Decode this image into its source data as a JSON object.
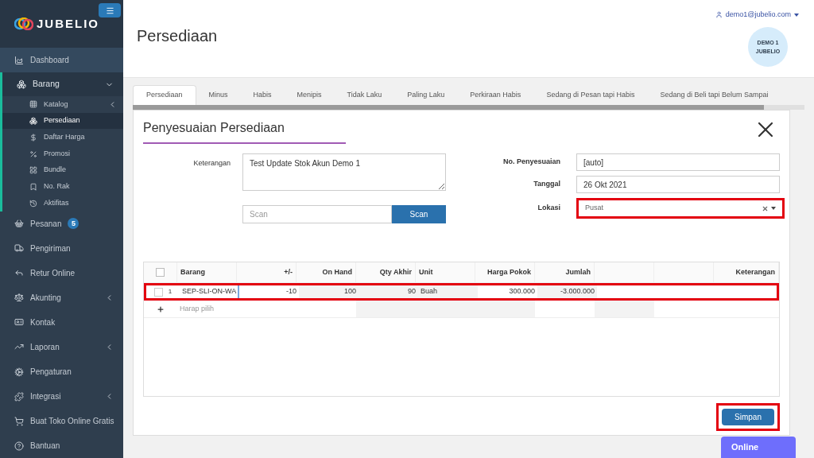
{
  "sidebar": {
    "logo": "JUBELIO",
    "items": [
      {
        "kind": "item",
        "label": "Dashboard"
      },
      {
        "kind": "group",
        "label": "Barang",
        "expanded": true,
        "children": [
          {
            "label": "Katalog",
            "selected": false
          },
          {
            "label": "Persediaan",
            "selected": true
          },
          {
            "label": "Daftar Harga",
            "selected": false
          },
          {
            "label": "Promosi",
            "selected": false
          },
          {
            "label": "Bundle",
            "selected": false
          },
          {
            "label": "No. Rak",
            "selected": false
          },
          {
            "label": "Aktifitas",
            "selected": false
          }
        ]
      },
      {
        "kind": "item",
        "label": "Pesanan",
        "badge": "5"
      },
      {
        "kind": "item",
        "label": "Pengiriman"
      },
      {
        "kind": "item",
        "label": "Retur Online"
      },
      {
        "kind": "item",
        "label": "Akunting"
      },
      {
        "kind": "item",
        "label": "Kontak"
      },
      {
        "kind": "item",
        "label": "Laporan"
      },
      {
        "kind": "item",
        "label": "Pengaturan"
      },
      {
        "kind": "item",
        "label": "Integrasi"
      },
      {
        "kind": "item",
        "label": "Buat Toko Online Gratis"
      },
      {
        "kind": "item",
        "label": "Bantuan"
      }
    ]
  },
  "header": {
    "title": "Persediaan",
    "user": "demo1@jubelio.com",
    "avatar": [
      "DEMO 1",
      "JUBELIO"
    ]
  },
  "tabs": [
    {
      "label": "Persediaan",
      "selected": true
    },
    {
      "label": "Minus",
      "selected": false
    },
    {
      "label": "Habis",
      "selected": false
    },
    {
      "label": "Menipis",
      "selected": false
    },
    {
      "label": "Tidak Laku",
      "selected": false
    },
    {
      "label": "Paling Laku",
      "selected": false
    },
    {
      "label": "Perkiraan Habis",
      "selected": false
    },
    {
      "label": "Sedang di Pesan tapi Habis",
      "selected": false
    },
    {
      "label": "Sedang di Beli tapi Belum Sampai",
      "selected": false
    }
  ],
  "form": {
    "title": "Penyesuaian Persediaan",
    "keterangan": {
      "label": "Keterangan",
      "value": "Test Update Stok Akun Demo 1"
    },
    "scan": {
      "placeholder": "Scan",
      "button": "Scan"
    },
    "no_penyesuaian": {
      "label": "No. Penyesuaian",
      "value": "[auto]"
    },
    "tanggal": {
      "label": "Tanggal",
      "value": "26 Okt 2021"
    },
    "lokasi": {
      "label": "Lokasi",
      "value": "Pusat",
      "highlighted": true
    }
  },
  "table": {
    "select_all": {
      "checked": false
    },
    "columns": [
      "Barang",
      "+/-",
      "On Hand",
      "Qty Akhir",
      "Unit",
      "Harga Pokok",
      "Jumlah",
      "",
      "",
      "Keterangan"
    ],
    "rows": [
      {
        "number": "1",
        "checked": false,
        "highlighted": true,
        "cells": [
          "SEP-SLI-ON-WA",
          "-10",
          "100",
          "90",
          "Buah",
          "300.000",
          "-3.000.000",
          "",
          "",
          ""
        ]
      }
    ],
    "add_row": {
      "placeholder": "Harap pilih"
    }
  },
  "save_button": {
    "label": "Simpan",
    "highlighted": true
  },
  "online_button": "Online"
}
